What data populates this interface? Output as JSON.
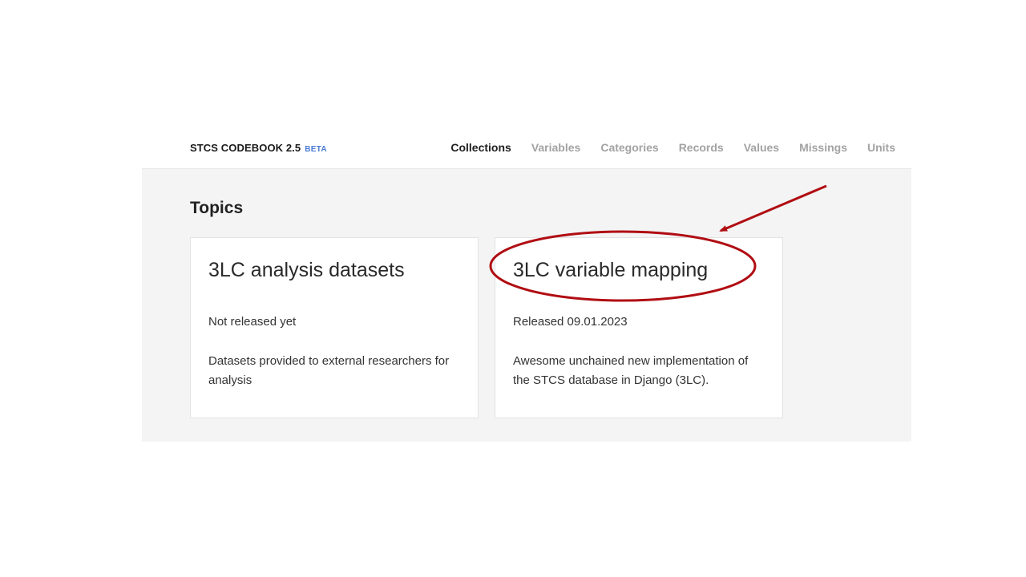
{
  "header": {
    "brand": "STCS CODEBOOK 2.5",
    "badge": "BETA",
    "nav": [
      {
        "label": "Collections",
        "active": true
      },
      {
        "label": "Variables",
        "active": false
      },
      {
        "label": "Categories",
        "active": false
      },
      {
        "label": "Records",
        "active": false
      },
      {
        "label": "Values",
        "active": false
      },
      {
        "label": "Missings",
        "active": false
      },
      {
        "label": "Units",
        "active": false
      }
    ]
  },
  "main": {
    "title": "Topics",
    "cards": [
      {
        "title": "3LC analysis datasets",
        "status": "Not released yet",
        "description": "Datasets provided to external researchers for analysis"
      },
      {
        "title": "3LC variable mapping",
        "status": "Released 09.01.2023",
        "description": "Awesome unchained new implementation of the STCS database in Django (3LC)."
      }
    ]
  },
  "annotation": {
    "color": "#b00d12",
    "highlighted_card": "3LC variable mapping"
  },
  "colors": {
    "nav_active": "#1f1f1f",
    "nav_inactive": "#a3a3a3",
    "beta": "#4a7bd4",
    "content_bg": "#f4f4f4"
  }
}
